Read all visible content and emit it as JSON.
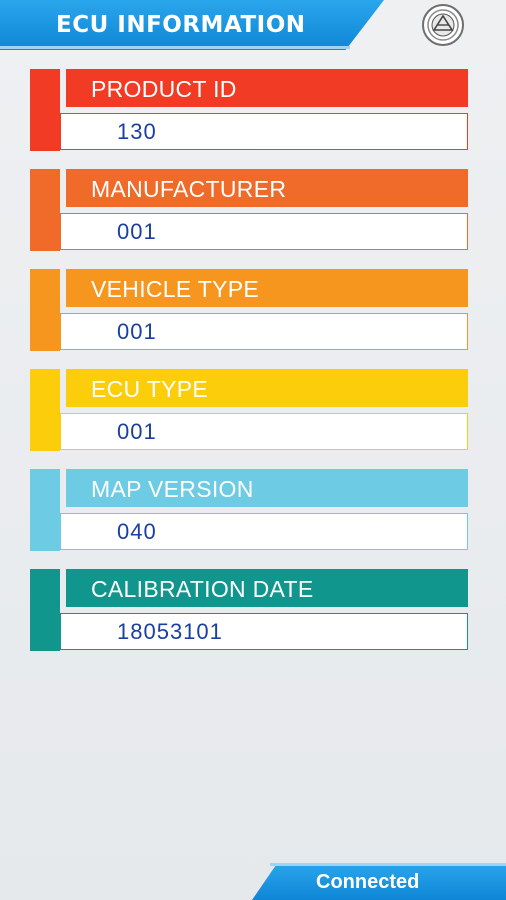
{
  "header": {
    "title": "ECU INFORMATION",
    "logo_icon": "seal-logo-icon"
  },
  "fields": [
    {
      "label": "PRODUCT ID",
      "value": "130",
      "color": "#f23b24"
    },
    {
      "label": "MANUFACTURER",
      "value": "001",
      "color": "#f06a29"
    },
    {
      "label": "VEHICLE TYPE",
      "value": "001",
      "color": "#f7961e"
    },
    {
      "label": "ECU TYPE",
      "value": "001",
      "color": "#fccd0a"
    },
    {
      "label": "MAP VERSION",
      "value": "040",
      "color": "#6dcbe3"
    },
    {
      "label": "CALIBRATION DATE",
      "value": "18053101",
      "color": "#10968c"
    }
  ],
  "footer": {
    "status": "Connected"
  },
  "colors": {
    "accent": "#1a96e2",
    "value_text": "#1b3fa0"
  }
}
